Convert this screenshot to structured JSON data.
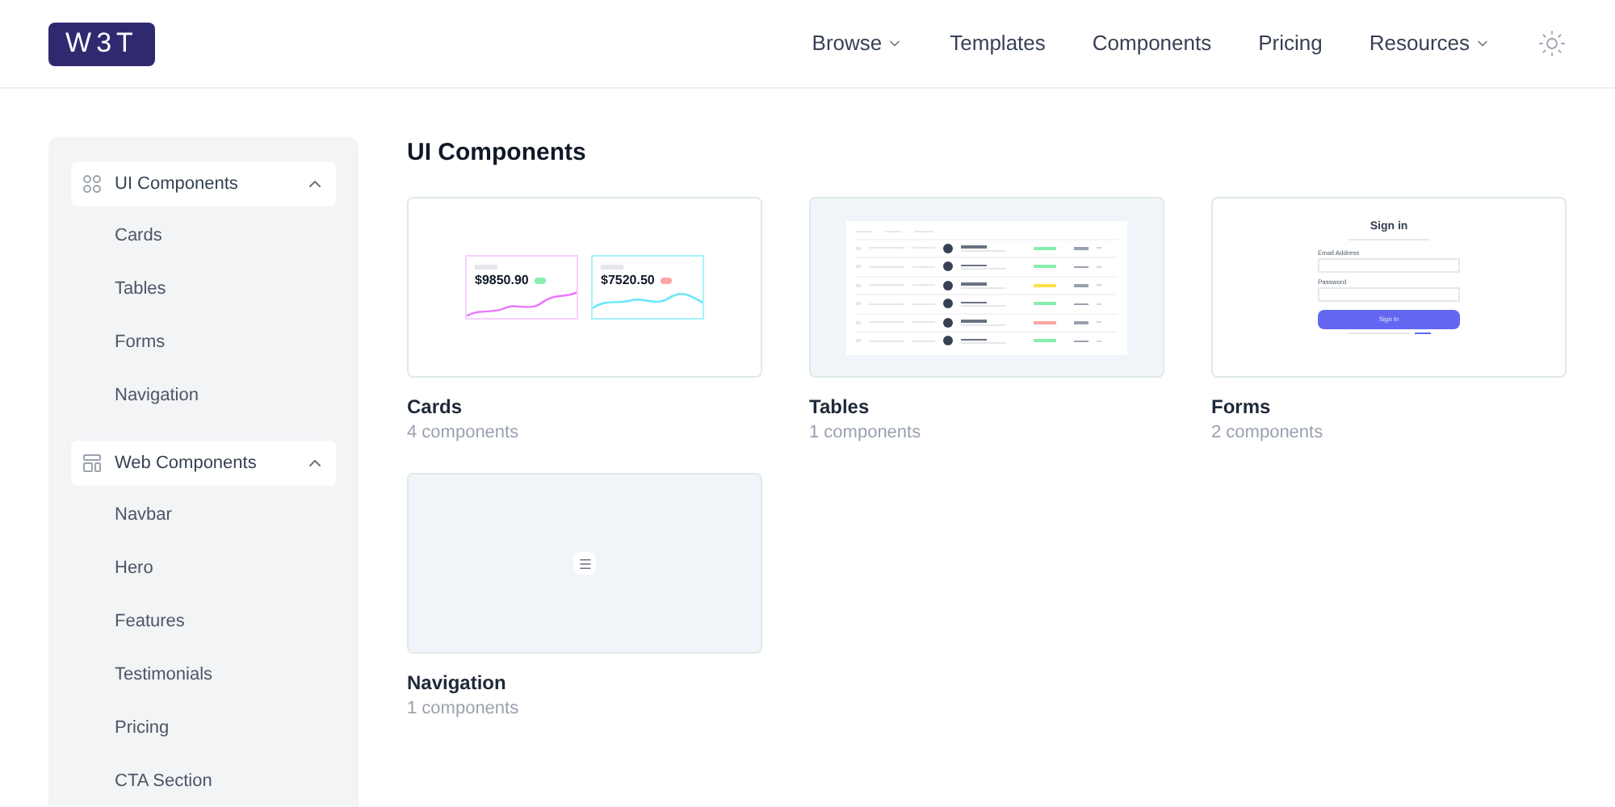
{
  "logo": "W3T",
  "nav": [
    {
      "label": "Browse",
      "dropdown": true
    },
    {
      "label": "Templates",
      "dropdown": false
    },
    {
      "label": "Components",
      "dropdown": false
    },
    {
      "label": "Pricing",
      "dropdown": false
    },
    {
      "label": "Resources",
      "dropdown": true
    }
  ],
  "sidebar": {
    "groups": [
      {
        "label": "UI Components",
        "kind": "grid",
        "expanded": true,
        "children": [
          {
            "label": "Cards"
          },
          {
            "label": "Tables"
          },
          {
            "label": "Forms"
          },
          {
            "label": "Navigation"
          }
        ]
      },
      {
        "label": "Web Components",
        "kind": "layout",
        "expanded": true,
        "children": [
          {
            "label": "Navbar"
          },
          {
            "label": "Hero"
          },
          {
            "label": "Features"
          },
          {
            "label": "Testimonials"
          },
          {
            "label": "Pricing"
          },
          {
            "label": "CTA Section"
          }
        ]
      }
    ]
  },
  "main": {
    "title": "UI Components",
    "cards": [
      {
        "title": "Cards",
        "subtitle": "4 components",
        "preview": {
          "kind": "stats",
          "stats": [
            {
              "value": "$9850.90",
              "color": "#86efac"
            },
            {
              "value": "$7520.50",
              "color": "#fca5a5"
            }
          ]
        }
      },
      {
        "title": "Tables",
        "subtitle": "1 components",
        "preview": {
          "kind": "table",
          "rows": [
            {
              "color": "#86efac"
            },
            {
              "color": "#86efac"
            },
            {
              "color": "#fde047"
            },
            {
              "color": "#86efac"
            },
            {
              "color": "#fca5a5"
            },
            {
              "color": "#86efac"
            }
          ]
        }
      },
      {
        "title": "Forms",
        "subtitle": "2 components",
        "preview": {
          "kind": "form",
          "heading": "Sign in",
          "fields": [
            "Email Address",
            "Password"
          ],
          "button": "Sign in"
        }
      },
      {
        "title": "Navigation",
        "subtitle": "1 components",
        "preview": {
          "kind": "menu"
        }
      }
    ]
  }
}
